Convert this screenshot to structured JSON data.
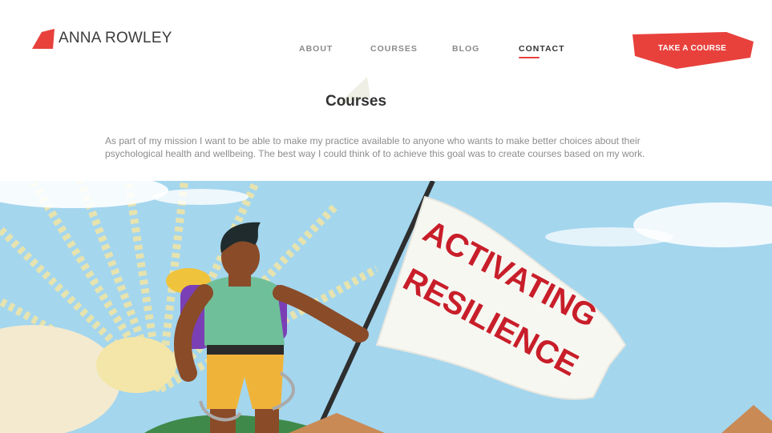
{
  "brand": {
    "name": "ANNA ROWLEY",
    "accent": "#e8413c"
  },
  "nav": {
    "items": [
      {
        "label": "ABOUT",
        "active": false
      },
      {
        "label": "COURSES",
        "active": false
      },
      {
        "label": "BLOG",
        "active": false
      },
      {
        "label": "CONTACT",
        "active": true
      }
    ]
  },
  "cta": {
    "label": "TAKE A COURSE"
  },
  "page": {
    "title": "Courses",
    "intro": "As part of my mission I want to be able to make my practice available to anyone who wants to make better choices about their psychological health and wellbeing. The best way I could think of to achieve this goal was to create courses based on my work."
  },
  "hero": {
    "flag_text_line1": "ACTIVATING",
    "flag_text_line2": "RESILIENCE",
    "colors": {
      "sky": "#9fd3ec",
      "flag_text": "#c81e2a",
      "shirt": "#6fbf9a",
      "backpack": "#7b3fb5"
    }
  }
}
